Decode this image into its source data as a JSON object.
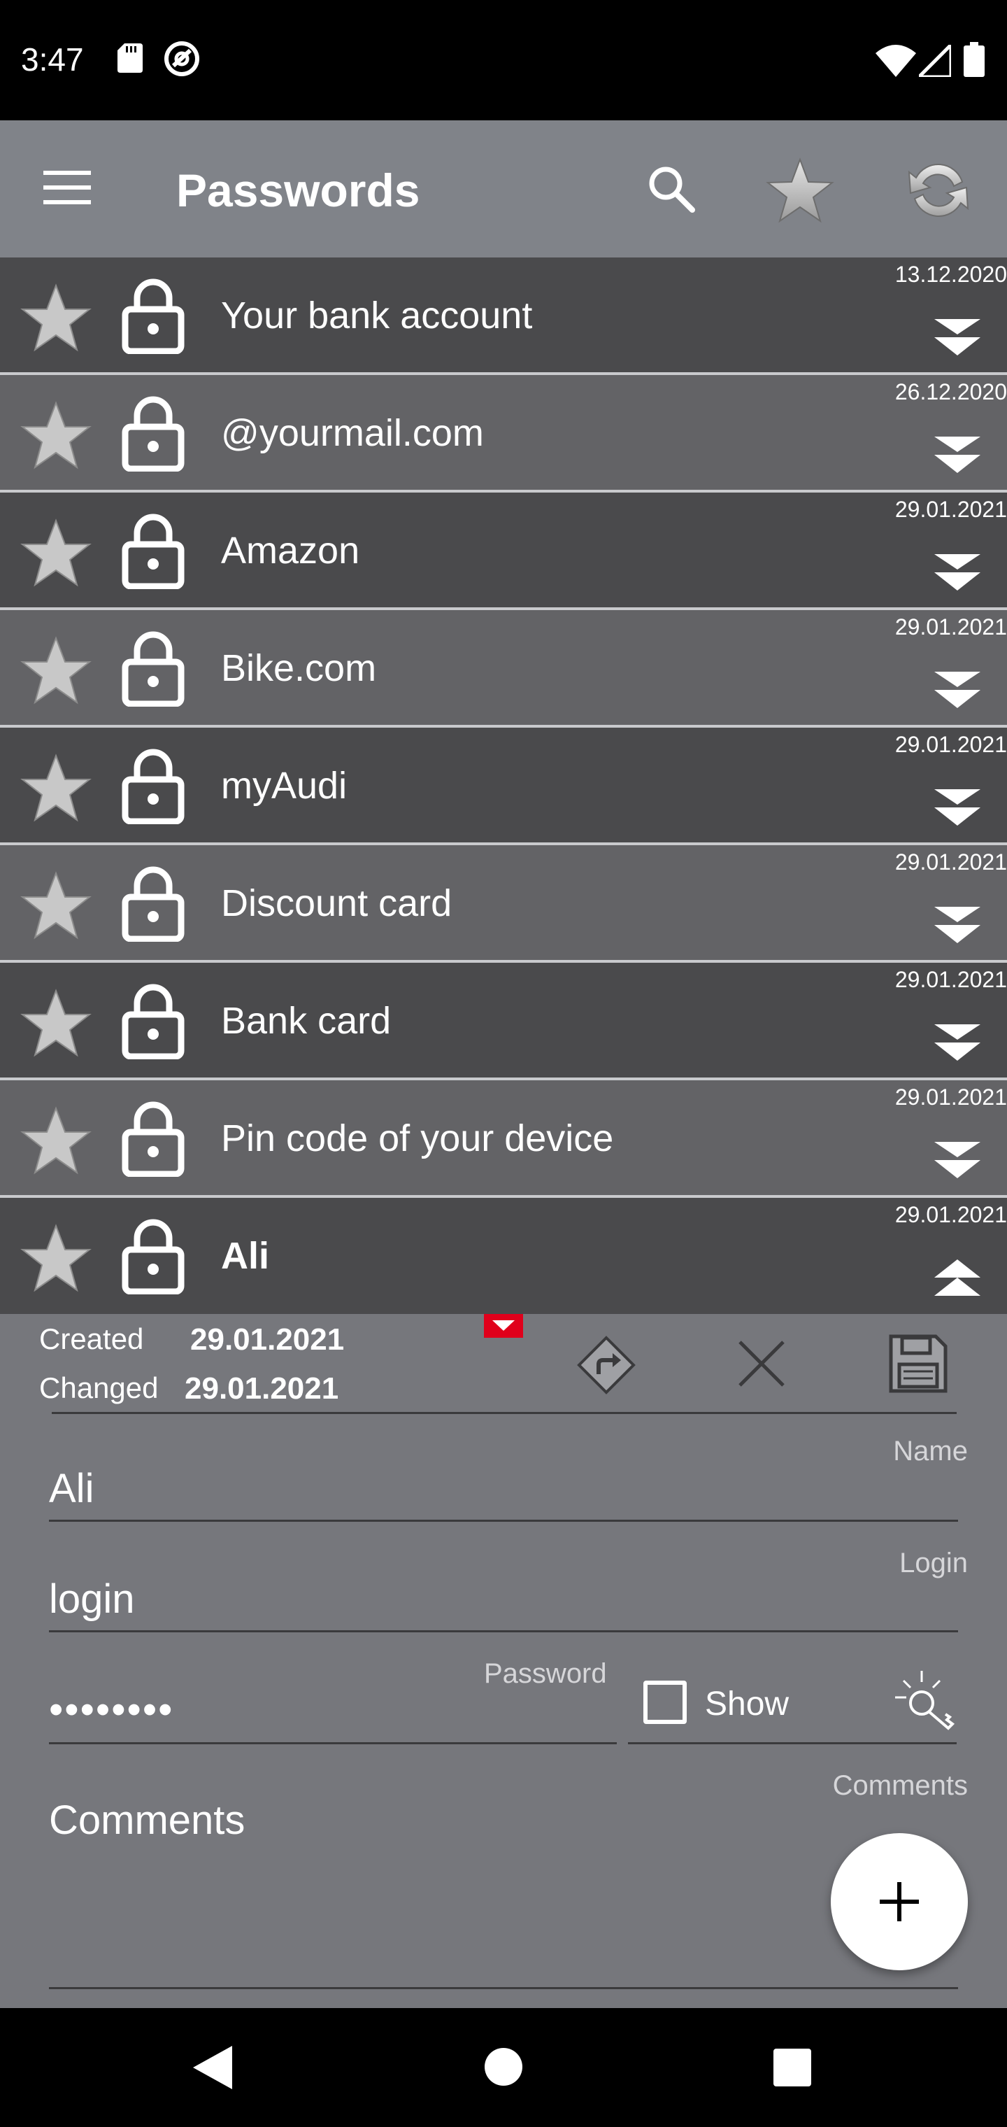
{
  "status_bar": {
    "time": "3:47",
    "icons": [
      "sd-card-icon",
      "at-sign-icon",
      "wifi-icon",
      "signal-icon",
      "battery-icon"
    ]
  },
  "app_bar": {
    "title": "Passwords",
    "actions": [
      "menu-icon",
      "search-icon",
      "star-icon",
      "refresh-icon"
    ]
  },
  "colors": {
    "app_bar_bg": "#808389",
    "row_dark": "#4a4a4c",
    "row_light": "#636366",
    "detail_bg": "#76777c",
    "accent_red": "#e0001b"
  },
  "entries": [
    {
      "name": "Your bank account",
      "date": "13.12.2020"
    },
    {
      "name": "@yourmail.com",
      "date": "26.12.2020"
    },
    {
      "name": "Amazon",
      "date": "29.01.2021"
    },
    {
      "name": "Bike.com",
      "date": "29.01.2021"
    },
    {
      "name": "myAudi",
      "date": "29.01.2021"
    },
    {
      "name": "Discount card",
      "date": "29.01.2021"
    },
    {
      "name": "Bank card",
      "date": "29.01.2021"
    },
    {
      "name": "Pin code of your device",
      "date": "29.01.2021"
    },
    {
      "name": "Ali",
      "date": "29.01.2021"
    }
  ],
  "detail": {
    "created_label": "Created",
    "created_value": "29.01.2021",
    "changed_label": "Changed",
    "changed_value": "29.01.2021",
    "name_label": "Name",
    "name_value": "Ali",
    "login_label": "Login",
    "login_value": "login",
    "password_label": "Password",
    "password_value": "••••••••",
    "show_label": "Show",
    "show_checked": false,
    "comments_label": "Comments",
    "comments_placeholder": "Comments"
  },
  "fab": {
    "icon": "plus-icon"
  },
  "nav_bar": {
    "icons": [
      "back-icon",
      "home-icon",
      "recents-icon"
    ]
  }
}
